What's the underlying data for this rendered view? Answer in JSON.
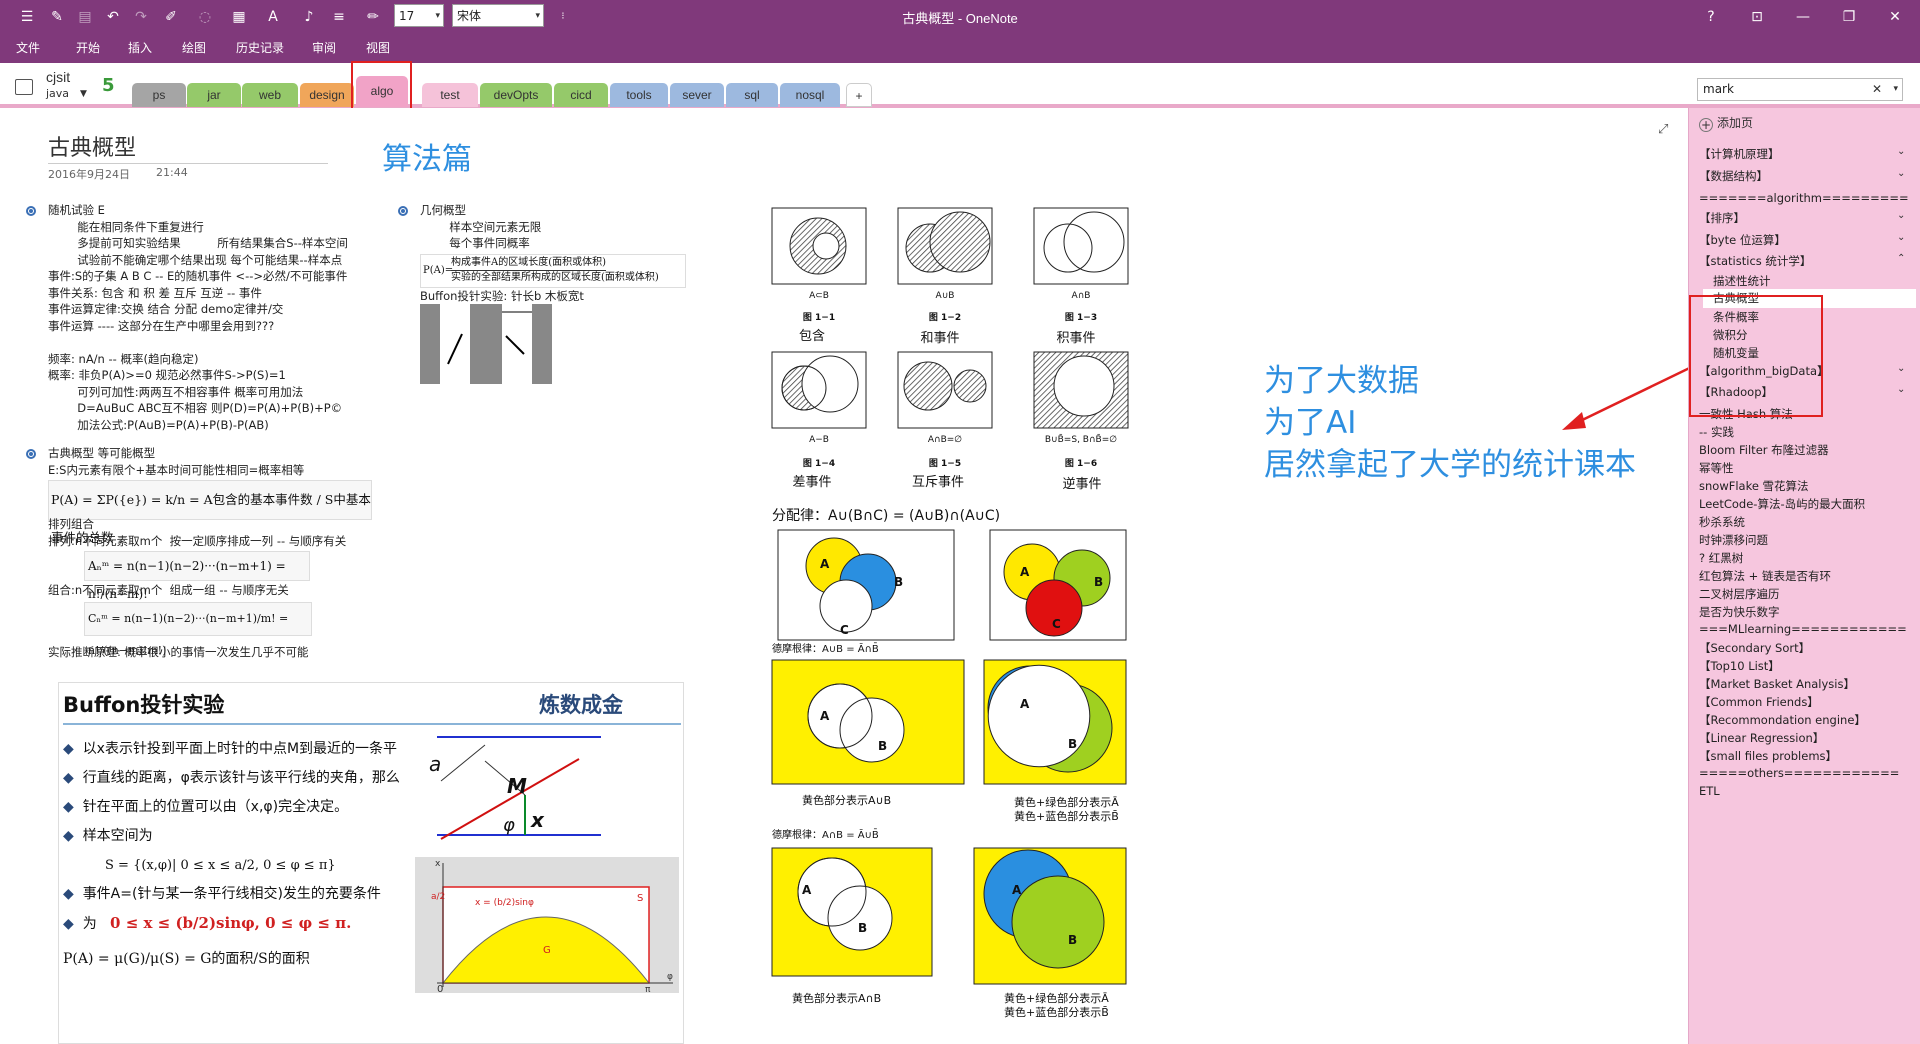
{
  "window": {
    "title": "古典概型 - OneNote",
    "help": "?",
    "restore_ribbon": "⊡",
    "minimize": "—",
    "maximize": "❐",
    "close": "✕"
  },
  "toolbar": {
    "font_size": "17",
    "font_name": "宋体"
  },
  "menu": [
    "文件",
    "开始",
    "插入",
    "绘图",
    "历史记录",
    "审阅",
    "视图"
  ],
  "notebook": {
    "name": "cjsit",
    "section": "java",
    "sync_icon": "5"
  },
  "tabs": [
    {
      "label": "ps",
      "color": "#A5A5A5"
    },
    {
      "label": "jar",
      "color": "#95C96A"
    },
    {
      "label": "web",
      "color": "#95C96A"
    },
    {
      "label": "design",
      "color": "#F0A65A"
    },
    {
      "label": "algo",
      "color": "#F1A3C7"
    },
    {
      "label": "test",
      "color": "#F5C2D9"
    },
    {
      "label": "devOpts",
      "color": "#95C96A"
    },
    {
      "label": "cicd",
      "color": "#95C96A"
    },
    {
      "label": "tools",
      "color": "#9DB9DF"
    },
    {
      "label": "sever",
      "color": "#9DB9DF"
    },
    {
      "label": "sql",
      "color": "#9DB9DF"
    },
    {
      "label": "nosql",
      "color": "#9DB9DF"
    },
    {
      "label": "+",
      "color": "#ffffff"
    }
  ],
  "search": {
    "value": "mark",
    "clear": "✕"
  },
  "page": {
    "title": "古典概型",
    "date": "2016年9月24日",
    "time": "21:44",
    "heading": "算法篇"
  },
  "notes": {
    "left1": "随机试验 E\n        能在相同条件下重复进行\n        多提前可知实验结果          所有结果集合S--样本空间\n        试验前不能确定哪个结果出现 每个可能结果--样本点\n事件:S的子集 A B C -- E的随机事件 <-->必然/不可能事件\n事件关系: 包含 和 积 差 互斥 互逆 -- 事件\n事件运算定律:交换 结合 分配 demo定律并/交\n事件运算 ---- 这部分在生产中哪里会用到???\n\n频率: nA/n -- 概率(趋向稳定)\n概率: 非负P(A)>=0 规范必然事件S->P(S)=1\n        可列可加性:两两互不相容事件 概率可用加法\n        D=AuBuC ABC互不相容 则P(D)=P(A)+P(B)+P©\n        加法公式:P(AuB)=P(A)+P(B)-P(AB)",
    "left2": "古典概型 等可能概型\nE:S内元素有限个+基本时间可能性相同=概率相等",
    "left3": "排列组合\n排列:n不同元素取m个  按一定顺序排成一列 -- 与顺序有关",
    "left4": "组合:n不同元素取m个  组成一组 -- 与顺序无关",
    "left5": "实际推断原理: 概率很小的事情一次发生几乎不可能",
    "mid1": "几何概型\n        样本空间元素无限\n        每个事件同概率",
    "mid2": "Buffon投针实验: 针长b 木板宽t"
  },
  "formulas": {
    "classical": "P(A) = ΣP({e}) = k/n = A包含的基本事件数 / S中基本事件的总数",
    "perm": "Aₙᵐ = n(n−1)(n−2)···(n−m+1) = n!/(n−m)!",
    "comb": "Cₙᵐ = n(n−1)(n−2)···(n−m+1)/m! = n!/((n−m)!m!)",
    "geom_num": "构成事件A的区域长度(面积或体积)",
    "geom_den": "实验的全部结果所构成的区域长度(面积或体积)",
    "geom_p": "P(A)="
  },
  "buffon": {
    "title": "Buffon投针实验",
    "logo": "炼数成金",
    "bullets": [
      "以x表示针投到平面上时针的中点M到最近的一条平",
      "行直线的距离，φ表示该针与该平行线的夹角，那么",
      "针在平面上的位置可以由（x,φ)完全决定。",
      "样本空间为",
      "事件A=(针与某一条平行线相交)发生的充要条件",
      "为"
    ],
    "sample_space": "S = {(x,φ)| 0 ≤ x ≤ a/2, 0 ≤ φ ≤ π}",
    "condition": "0 ≤ x ≤ (b/2)sinφ,   0 ≤ φ ≤ π.",
    "prob": "P(A) = μ(G)/μ(S) = G的面积/S的面积",
    "fig_a": "a",
    "fig_m": "M",
    "fig_phi": "φ",
    "fig_x": "x",
    "graph_x": "x",
    "graph_o": "0",
    "graph_pi": "π",
    "graph_phi": "φ",
    "graph_a2": "a/2",
    "graph_curve": "x = (b/2)sinφ",
    "graph_s": "S",
    "graph_g": "G"
  },
  "venn1": {
    "captions": [
      "A⊂B",
      "A∪B",
      "A∩B",
      "A−B",
      "A∩B=∅",
      "B∪B̄=S, B∩B̄=∅"
    ],
    "figs": [
      "图 1−1",
      "图 1−2",
      "图 1−3",
      "图 1−4",
      "图 1−5",
      "图 1−6"
    ],
    "names": [
      "包含",
      "和事件",
      "积事件",
      "差事件",
      "互斥事件",
      "逆事件"
    ]
  },
  "venn2": {
    "title": "分配律：A∪(B∩C) = (A∪B)∩(A∪C)",
    "demorgan1": "德摩根律：A∪B = Ā∩B̄",
    "demorgan2": "德摩根律：A∩B = Ā∪B̄",
    "cap1": "黄色部分表示A∪B",
    "cap2a": "黄色+绿色部分表示Ā",
    "cap2b": "黄色+蓝色部分表示B̄",
    "cap3": "黄色部分表示A∩B",
    "cap4a": "黄色+绿色部分表示Ā",
    "cap4b": "黄色+蓝色部分表示B̄",
    "a": "A",
    "b": "B",
    "c": "C"
  },
  "annotation": "为了大数据\n为了AI\n居然拿起了大学的统计课本",
  "sidebar": {
    "add_page": "添加页",
    "pages": [
      {
        "label": "【计算机原理】",
        "chev": "⌄"
      },
      {
        "label": "【数据结构】",
        "chev": "⌄"
      },
      {
        "label": "=======algorithm=========",
        "chev": ""
      },
      {
        "label": "【排序】",
        "chev": "⌄"
      },
      {
        "label": "【byte 位运算】",
        "chev": "⌄"
      },
      {
        "label": "【statistics 统计学】",
        "chev": "⌃"
      },
      {
        "label": "描述性统计",
        "chev": "",
        "sub": true
      },
      {
        "label": "古典概型",
        "chev": "",
        "sub": true,
        "selected": true
      },
      {
        "label": "条件概率",
        "chev": "",
        "sub": true
      },
      {
        "label": "微积分",
        "chev": "",
        "sub": true
      },
      {
        "label": "随机变量",
        "chev": "",
        "sub": true
      },
      {
        "label": "【algorithm_bigData】",
        "chev": "⌄"
      },
      {
        "label": "【Rhadoop】",
        "chev": "⌄"
      },
      {
        "label": "一致性 Hash 算法",
        "chev": ""
      },
      {
        "label": "-- 实践",
        "chev": ""
      },
      {
        "label": "Bloom Filter 布隆过滤器",
        "chev": ""
      },
      {
        "label": "幂等性",
        "chev": ""
      },
      {
        "label": "snowFlake 雪花算法",
        "chev": ""
      },
      {
        "label": "LeetCode-算法-岛屿的最大面积",
        "chev": ""
      },
      {
        "label": "秒杀系统",
        "chev": ""
      },
      {
        "label": "时钟漂移问题",
        "chev": ""
      },
      {
        "label": "? 红黑树",
        "chev": ""
      },
      {
        "label": "红包算法 + 链表是否有环",
        "chev": ""
      },
      {
        "label": "二叉树层序遍历",
        "chev": ""
      },
      {
        "label": "是否为快乐数字",
        "chev": ""
      },
      {
        "label": "===MLlearning============",
        "chev": ""
      },
      {
        "label": "【Secondary Sort】",
        "chev": ""
      },
      {
        "label": "【Top10 List】",
        "chev": ""
      },
      {
        "label": "【Market Basket Analysis】",
        "chev": ""
      },
      {
        "label": "【Common Friends】",
        "chev": ""
      },
      {
        "label": "【Recommondation engine】",
        "chev": ""
      },
      {
        "label": "【Linear Regression】",
        "chev": ""
      },
      {
        "label": "【small files problems】",
        "chev": ""
      },
      {
        "label": "=====others============",
        "chev": ""
      },
      {
        "label": "ETL",
        "chev": ""
      }
    ]
  },
  "colors": {
    "brand": "#80397B",
    "accent_blue": "#2E8FE0",
    "highlight_red": "#E02020",
    "sidebar": "#F6C6DE"
  }
}
